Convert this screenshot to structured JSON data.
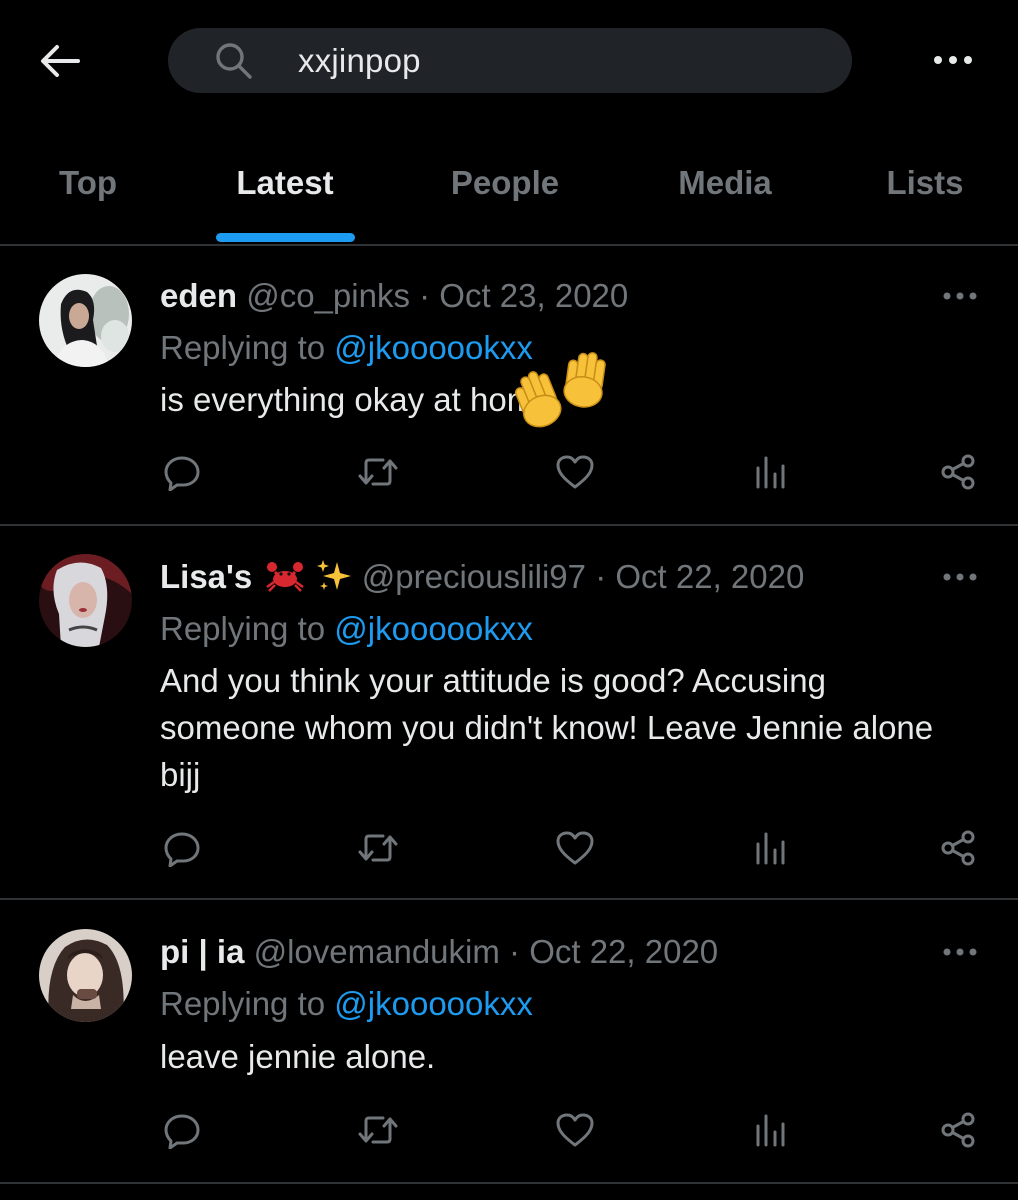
{
  "header": {
    "search": {
      "query": "xxjinpop"
    }
  },
  "tabs": [
    {
      "label": "Top",
      "active": false
    },
    {
      "label": "Latest",
      "active": true
    },
    {
      "label": "People",
      "active": false
    },
    {
      "label": "Media",
      "active": false
    },
    {
      "label": "Lists",
      "active": false
    }
  ],
  "tweets": [
    {
      "name": "eden",
      "handle": "@co_pinks",
      "separator": "·",
      "date": "Oct 23, 2020",
      "reply_prefix": "Replying to",
      "reply_to": "@jkoooookxx",
      "body": "is everything okay at home",
      "overlay_emoji": "waving-hands"
    },
    {
      "name": "Lisa's",
      "name_emojis": [
        "crab",
        "sparkles"
      ],
      "handle": "@preciouslili97",
      "separator": "·",
      "date": "Oct 22, 2020",
      "reply_prefix": "Replying to",
      "reply_to": "@jkoooookxx",
      "body": "And you think your attitude is good? Accusing someone whom you didn't know! Leave Jennie alone bijj"
    },
    {
      "name": "pi | ia",
      "handle": "@lovemandukim",
      "separator": "·",
      "date": "Oct 22, 2020",
      "reply_prefix": "Replying to",
      "reply_to": "@jkoooookxx",
      "body": "leave jennie alone."
    }
  ],
  "icons": {
    "back": "arrow-left-icon",
    "search": "search-icon",
    "more": "more-horizontal-icon",
    "reply": "reply-icon",
    "retweet": "retweet-icon",
    "like": "heart-icon",
    "views": "bar-chart-icon",
    "share": "share-icon"
  },
  "colors": {
    "background": "#000000",
    "text": "#e7e9ea",
    "muted": "#71767b",
    "accent": "#1d9bf0",
    "divider": "#2f3336",
    "search_bg": "#202327"
  }
}
